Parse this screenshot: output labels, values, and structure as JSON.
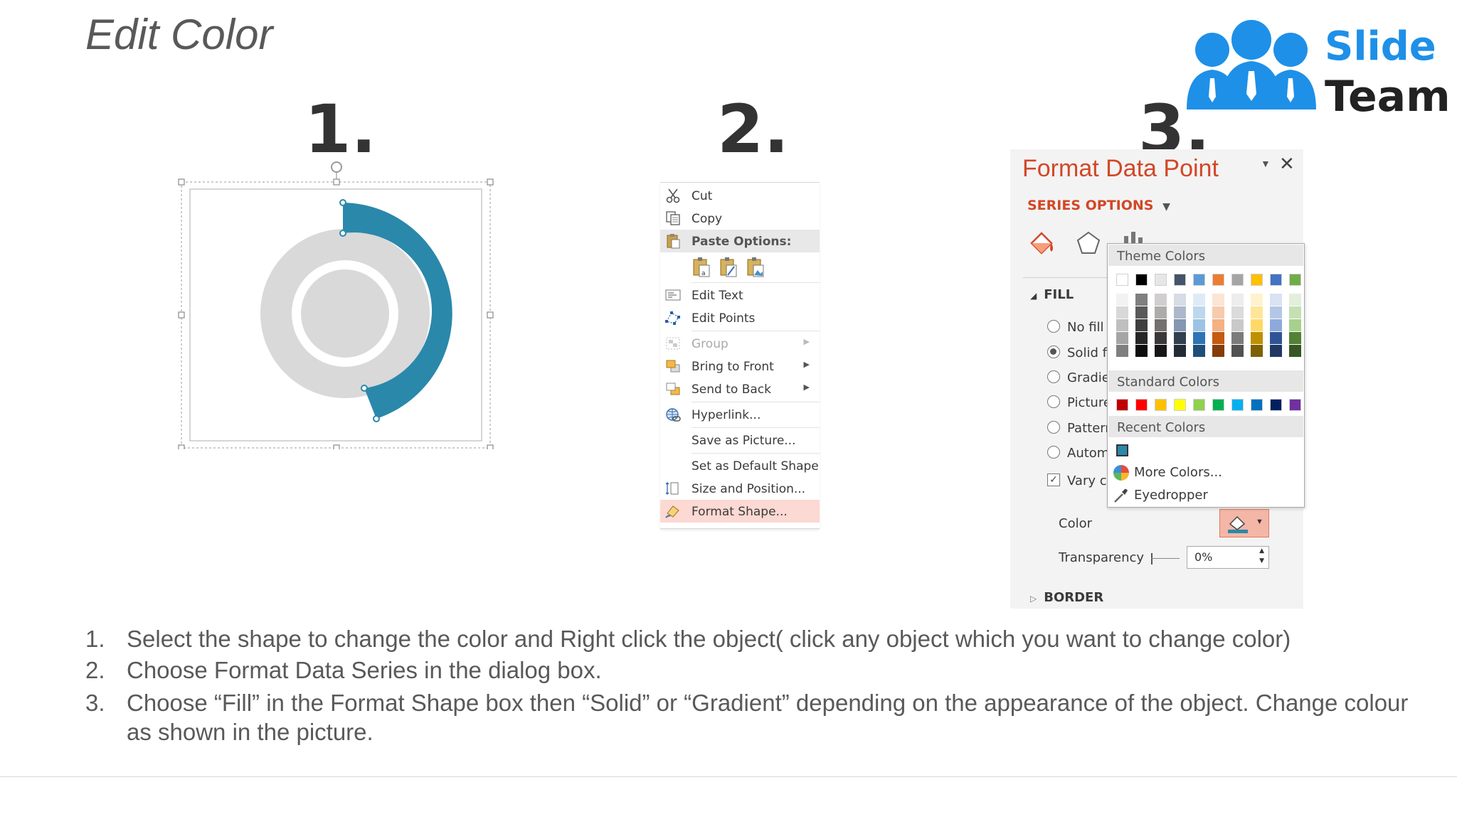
{
  "page_title": "Edit Color",
  "logo": {
    "line1": "Slide",
    "line2": "Team"
  },
  "steps": [
    "1.",
    "2.",
    "3."
  ],
  "colors": {
    "donut_accent": "#2a88ab",
    "donut_grey": "#d9d9d9",
    "pane_title": "#d24726",
    "menu_highlight": "#fcd9d2"
  },
  "context_menu": {
    "items": [
      {
        "label": "Cut",
        "icon": "scissors-icon"
      },
      {
        "label": "Copy",
        "icon": "copy-icon"
      },
      {
        "label": "Paste Options:",
        "icon": "paste-icon"
      },
      {
        "label": "Edit Text",
        "icon": "edit-text-icon"
      },
      {
        "label": "Edit Points",
        "icon": "edit-points-icon"
      },
      {
        "label": "Group",
        "icon": "group-icon"
      },
      {
        "label": "Bring to Front",
        "icon": "bring-front-icon"
      },
      {
        "label": "Send to Back",
        "icon": "send-back-icon"
      },
      {
        "label": "Hyperlink...",
        "icon": "hyperlink-icon"
      },
      {
        "label": "Save as Picture...",
        "icon": ""
      },
      {
        "label": "Set as Default Shape",
        "icon": ""
      },
      {
        "label": "Size and Position...",
        "icon": "size-position-icon"
      },
      {
        "label": "Format Shape...",
        "icon": "format-shape-icon"
      }
    ]
  },
  "format_pane": {
    "title": "Format Data Point",
    "series_options": "SERIES OPTIONS",
    "fill_header": "FILL",
    "fill_options": [
      "No fill",
      "Solid fi",
      "Gradie",
      "Picture",
      "Pattern",
      "Autom",
      "Vary co"
    ],
    "color_label": "Color",
    "transparency_label": "Transparency",
    "transparency_value": "0%",
    "border_header": "BORDER",
    "popup": {
      "theme_colors": "Theme Colors",
      "standard_colors": "Standard Colors",
      "recent_colors": "Recent Colors",
      "more_colors": "More Colors...",
      "eyedropper": "Eyedropper",
      "theme_top": [
        "#ffffff",
        "#000000",
        "#e7e6e6",
        "#44546a",
        "#5b9bd5",
        "#ed7d31",
        "#a5a5a5",
        "#ffc000",
        "#4472c4",
        "#70ad47"
      ],
      "theme_shades": [
        [
          "#f2f2f2",
          "#7f7f7f",
          "#d0cece",
          "#d6dce4",
          "#deebf6",
          "#fbe5d5",
          "#ededed",
          "#fff2cc",
          "#d9e2f3",
          "#e2efd9"
        ],
        [
          "#d8d8d8",
          "#595959",
          "#aeabab",
          "#adb9ca",
          "#bdd7ee",
          "#f7cbac",
          "#dbdbdb",
          "#ffe598",
          "#b4c6e7",
          "#c5e0b3"
        ],
        [
          "#bfbfbf",
          "#3f3f3f",
          "#757070",
          "#8496b0",
          "#9cc3e5",
          "#f4b183",
          "#c9c9c9",
          "#ffd965",
          "#8eaadb",
          "#a8d08d"
        ],
        [
          "#a5a5a5",
          "#262626",
          "#3a3838",
          "#323f4f",
          "#2e75b5",
          "#c55a11",
          "#7b7b7b",
          "#bf9000",
          "#2f5496",
          "#538135"
        ],
        [
          "#7f7f7f",
          "#0c0c0c",
          "#171616",
          "#222a35",
          "#1e4e79",
          "#843c0b",
          "#525252",
          "#7f6000",
          "#1f3864",
          "#375623"
        ]
      ],
      "standard": [
        "#c00000",
        "#ff0000",
        "#ffc000",
        "#ffff00",
        "#92d050",
        "#00b050",
        "#00b0f0",
        "#0070c0",
        "#002060",
        "#7030a0"
      ],
      "recent": [
        "#2a88ab"
      ]
    }
  },
  "instructions": [
    {
      "n": "1.",
      "text": "Select the shape to change the color and Right click the object( click any object which you want to change color)"
    },
    {
      "n": "2.",
      "text": "Choose Format Data Series in the dialog box."
    },
    {
      "n": "3.",
      "text": "Choose “Fill” in the Format Shape box then “Solid” or “Gradient” depending on the appearance of the object. Change colour as shown in the picture."
    }
  ]
}
